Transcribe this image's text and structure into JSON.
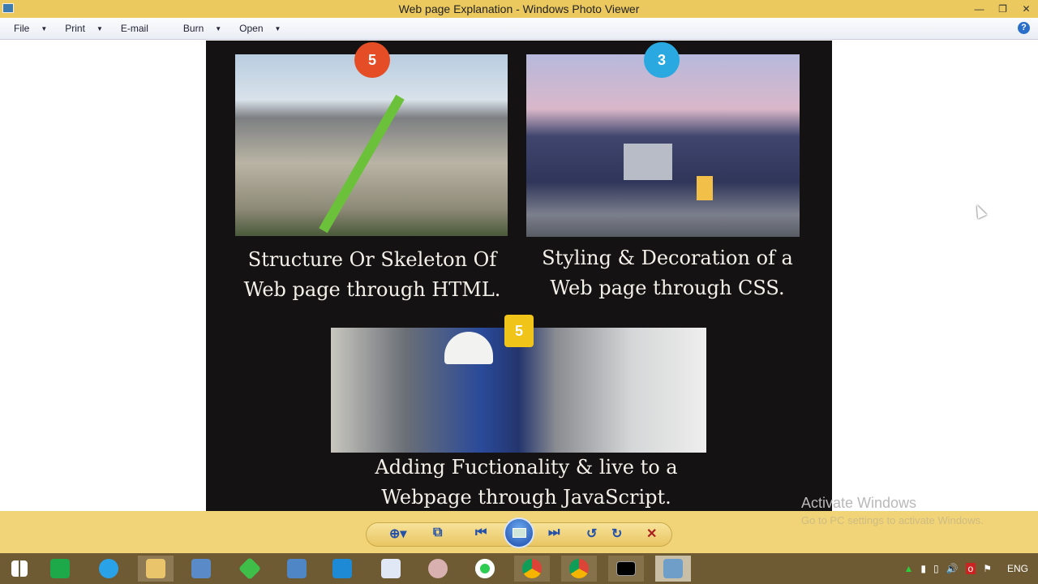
{
  "window": {
    "title": "Web page Explanation - Windows Photo Viewer"
  },
  "menu": [
    {
      "label": "File",
      "dropdown": true
    },
    {
      "label": "Print",
      "dropdown": true
    },
    {
      "label": "E-mail",
      "dropdown": false
    },
    {
      "label": "Burn",
      "dropdown": true
    },
    {
      "label": "Open",
      "dropdown": true
    }
  ],
  "slide": {
    "html_badge": "5",
    "css_badge": "3",
    "js_badge": "5",
    "html_caption_1": "Structure Or Skeleton Of",
    "html_caption_2": "Web page through HTML.",
    "css_caption_1": "Styling & Decoration of a",
    "css_caption_2": "Web page through CSS.",
    "js_caption_1": "Adding Fuctionality & live  to  a",
    "js_caption_2": "Webpage through JavaScript."
  },
  "watermark": {
    "title": "Activate Windows",
    "subtitle": "Go to PC settings to activate Windows."
  },
  "tray": {
    "language": "ENG"
  },
  "colors": {
    "titlebar": "#ebc95e",
    "toolbar": "#f1d477",
    "slide_bg": "#141212",
    "html": "#e44d26",
    "css": "#29a9df",
    "js": "#f0c419"
  }
}
